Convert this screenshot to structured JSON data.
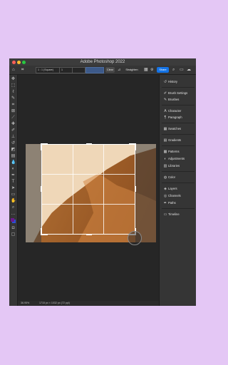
{
  "window": {
    "title": "Adobe Photoshop 2022"
  },
  "options_bar": {
    "home_icon": "home-icon",
    "crop_tool_icon": "crop-icon",
    "ratio_select": "1 : 1 (Square)",
    "ratio_value": "1",
    "clear_label": "Clear",
    "straighten_label": "Straighten",
    "share_label": "Share"
  },
  "tools": [
    "move-icon",
    "marquee-icon",
    "lasso-icon",
    "quick-select-icon",
    "crop-icon",
    "frame-icon",
    "eyedropper-icon",
    "healing-icon",
    "brush-icon",
    "clone-stamp-icon",
    "history-brush-icon",
    "eraser-icon",
    "gradient-icon",
    "blur-icon",
    "dodge-icon",
    "pen-icon",
    "type-icon",
    "path-select-icon",
    "rectangle-icon",
    "hand-icon",
    "zoom-icon",
    "more-icon"
  ],
  "status": {
    "zoom": "36.95%",
    "doc_size": "1715 px × 1032 px (72 ppi)"
  },
  "panels": [
    {
      "icon": "history-icon",
      "label": "History"
    },
    {
      "icon": "brush-settings-icon",
      "label": "Brush Settings"
    },
    {
      "icon": "brushes-icon",
      "label": "Brushes"
    },
    {
      "icon": "character-icon",
      "label": "Character"
    },
    {
      "icon": "paragraph-icon",
      "label": "Paragraph"
    },
    {
      "icon": "swatches-icon",
      "label": "Swatches"
    },
    {
      "icon": "gradients-icon",
      "label": "Gradients"
    },
    {
      "icon": "patterns-icon",
      "label": "Patterns"
    },
    {
      "icon": "adjustments-icon",
      "label": "Adjustments"
    },
    {
      "icon": "libraries-icon",
      "label": "Libraries"
    },
    {
      "icon": "color-icon",
      "label": "Color"
    },
    {
      "icon": "layers-icon",
      "label": "Layers"
    },
    {
      "icon": "channels-icon",
      "label": "Channels"
    },
    {
      "icon": "paths-icon",
      "label": "Paths"
    },
    {
      "icon": "timeline-icon",
      "label": "Timeline"
    }
  ],
  "colors": {
    "background": "#e4c7f5",
    "share_button": "#1473e6",
    "foreground": "#6b1a8c",
    "background_swatch": "#2a4fd6"
  }
}
